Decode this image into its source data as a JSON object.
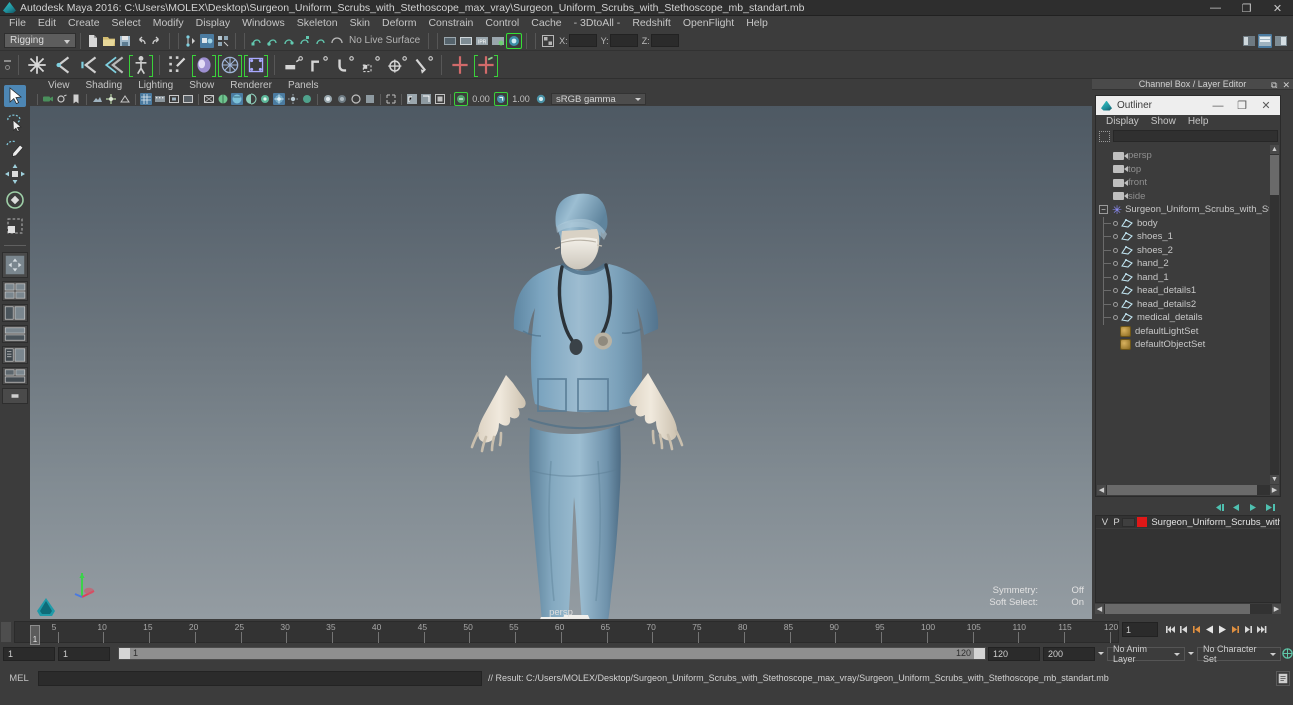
{
  "window": {
    "title": "Autodesk Maya 2016: C:\\Users\\MOLEX\\Desktop\\Surgeon_Uniform_Scrubs_with_Stethoscope_max_vray\\Surgeon_Uniform_Scrubs_with_Stethoscope_mb_standart.mb",
    "minimize": "—",
    "maximize": "❐",
    "close": "✕",
    "app_icon": "maya-logo-icon"
  },
  "menubar": {
    "items": [
      "File",
      "Edit",
      "Create",
      "Select",
      "Modify",
      "Display",
      "Windows",
      "Skeleton",
      "Skin",
      "Deform",
      "Constrain",
      "Control",
      "Cache",
      "- 3DtoAll -",
      "Redshift",
      "OpenFlight",
      "Help"
    ]
  },
  "status_toolbar": {
    "menu_set": "Rigging",
    "live_surface_label": "No Live Surface",
    "coord_labels": [
      "X:",
      "Y:",
      "Z:"
    ],
    "coord_values": [
      "",
      "",
      ""
    ]
  },
  "shelf": {
    "name": "Rigging",
    "buttons": [
      "create-joint-icon",
      "ik-handle-icon",
      "ik-spline-handle-icon",
      "ik-spline-icon",
      "bind-skin-icon",
      "paint-skin-weights-icon",
      "interactive-bind-icon",
      "smooth-bind-icon",
      "mirror-skin-weights-icon",
      "parent-constraint-icon",
      "point-constraint-icon",
      "orient-constraint-icon",
      "scale-constraint-icon",
      "aim-constraint-icon",
      "pole-vector-icon",
      "lattice-icon",
      "cluster-icon"
    ]
  },
  "toolbox": {
    "tools": [
      "select-tool-icon",
      "lasso-select-tool-icon",
      "paint-select-tool-icon",
      "move-tool-icon",
      "rotate-tool-icon",
      "scale-tool-icon"
    ],
    "layouts": [
      "single-perspective-view-icon",
      "four-view-icon",
      "two-pane-side-icon",
      "two-pane-stacked-icon",
      "outliner-persp-icon",
      "hypershade-persp-icon",
      "persp-graph-icon"
    ]
  },
  "viewport": {
    "menus": [
      "View",
      "Shading",
      "Lighting",
      "Show",
      "Renderer",
      "Panels"
    ],
    "exposure_value": "0.00",
    "gamma_value": "1.00",
    "color_profile": "sRGB gamma",
    "camera_label": "persp",
    "hud": [
      {
        "label": "Symmetry:",
        "value": "Off"
      },
      {
        "label": "Soft Select:",
        "value": "On"
      }
    ],
    "axis_gizmo": "axis-gizmo-icon",
    "model": {
      "name": "Surgeon Uniform Scrubs with Stethoscope",
      "scrub_color": "#7fa3bb",
      "skin_color": "#e8e0d2",
      "shoe_color": "#e9e9e6",
      "background_top": "#4e5963",
      "background_bottom": "#949ca2"
    }
  },
  "channelbox": {
    "title": "Channel Box / Layer Editor",
    "float_icon": "undock-icon",
    "close_icon": "close-icon"
  },
  "outliner": {
    "title": "Outliner",
    "window_icon": "maya-logo-icon",
    "minimize": "—",
    "maximize": "❐",
    "close": "✕",
    "menus": [
      "Display",
      "Show",
      "Help"
    ],
    "search_value": "",
    "search_placeholder": "",
    "nodes": [
      {
        "label": "persp",
        "type": "camera",
        "indent": 0,
        "dim": true
      },
      {
        "label": "top",
        "type": "camera",
        "indent": 0,
        "dim": true
      },
      {
        "label": "front",
        "type": "camera",
        "indent": 0,
        "dim": true
      },
      {
        "label": "side",
        "type": "camera",
        "indent": 0,
        "dim": true
      },
      {
        "label": "Surgeon_Uniform_Scrubs_with_Stethos",
        "type": "group",
        "indent": 0,
        "dim": false,
        "expanded": true
      },
      {
        "label": "body",
        "type": "mesh",
        "indent": 1,
        "dim": false
      },
      {
        "label": "shoes_1",
        "type": "mesh",
        "indent": 1,
        "dim": false
      },
      {
        "label": "shoes_2",
        "type": "mesh",
        "indent": 1,
        "dim": false
      },
      {
        "label": "hand_2",
        "type": "mesh",
        "indent": 1,
        "dim": false
      },
      {
        "label": "hand_1",
        "type": "mesh",
        "indent": 1,
        "dim": false
      },
      {
        "label": "head_details1",
        "type": "mesh",
        "indent": 1,
        "dim": false
      },
      {
        "label": "head_details2",
        "type": "mesh",
        "indent": 1,
        "dim": false
      },
      {
        "label": "medical_details",
        "type": "mesh",
        "indent": 1,
        "dim": false
      },
      {
        "label": "defaultLightSet",
        "type": "set",
        "indent": 0,
        "dim": false
      },
      {
        "label": "defaultObjectSet",
        "type": "set",
        "indent": 0,
        "dim": false
      }
    ]
  },
  "layer_editor": {
    "toolbuttons": [
      "new-layer-icon",
      "new-layer-from-selected-icon",
      "layer-options-icon",
      "layer-options2-icon"
    ],
    "columns": [
      "V",
      "P"
    ],
    "rows": [
      {
        "visible": "",
        "playback": "",
        "color": "#e01818",
        "name": "Surgeon_Uniform_Scrubs_with_Stet"
      }
    ]
  },
  "timeline": {
    "start_frame": "1",
    "end_frame": "120",
    "current_frame": "1",
    "playback_frame": "1",
    "ticks": [
      5,
      10,
      15,
      20,
      25,
      30,
      35,
      40,
      45,
      50,
      55,
      60,
      65,
      70,
      75,
      80,
      85,
      90,
      95,
      100,
      105,
      110,
      115,
      120
    ],
    "playback_buttons": [
      "go-to-start-icon",
      "step-back-key-icon",
      "step-back-frame-icon",
      "play-backwards-icon",
      "play-forwards-icon",
      "step-forward-frame-icon",
      "step-forward-key-icon",
      "go-to-end-icon"
    ]
  },
  "range_bar": {
    "range_start": "1",
    "range_end": "1",
    "slider_start_label": "1",
    "slider_end_label": "120",
    "anim_end": "120",
    "playback_end": "200",
    "anim_layer": "No Anim Layer",
    "character_set": "No Character Set",
    "auto_key_icon": "auto-keyframe-icon",
    "anim_prefs_icon": "animation-preferences-icon"
  },
  "command_line": {
    "language": "MEL",
    "input_value": "",
    "result": "// Result: C:/Users/MOLEX/Desktop/Surgeon_Uniform_Scrubs_with_Stethoscope_max_vray/Surgeon_Uniform_Scrubs_with_Stethoscope_mb_standart.mb",
    "script_editor_icon": "script-editor-icon"
  }
}
